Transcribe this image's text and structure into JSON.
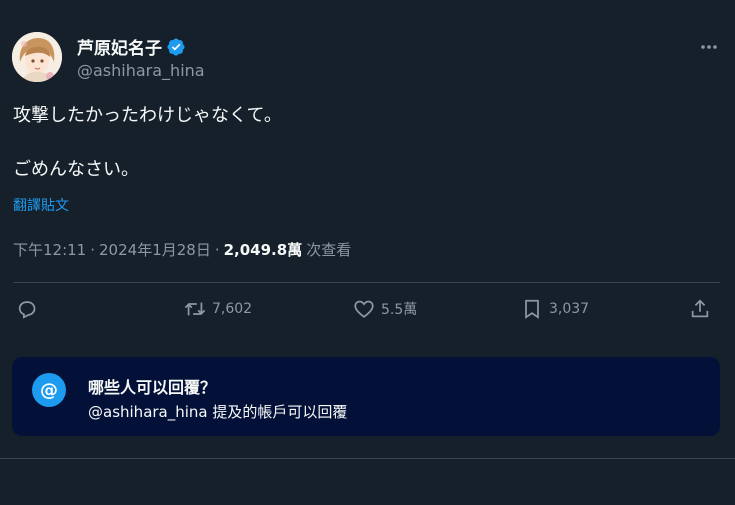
{
  "author": {
    "display_name": "芦原妃名子",
    "handle": "@ashihara_hina",
    "verified": true
  },
  "tweet": {
    "text": "攻撃したかったわけじゃなくて。\n\nごめんなさい。",
    "translate_label": "翻譯貼文"
  },
  "meta": {
    "time": "下午12:11",
    "date": "2024年1月28日",
    "separator": "·",
    "views_count": "2,049.8萬",
    "views_label": "次查看"
  },
  "actions": {
    "retweets": "7,602",
    "likes": "5.5萬",
    "bookmarks": "3,037"
  },
  "reply_restriction": {
    "icon": "@",
    "title": "哪些人可以回覆？",
    "description": "@ashihara_hina 提及的帳戶可以回覆"
  },
  "colors": {
    "background": "#15202b",
    "accent": "#1d9bf0",
    "secondary_text": "#8b98a5",
    "reply_box_bg": "#031138"
  }
}
